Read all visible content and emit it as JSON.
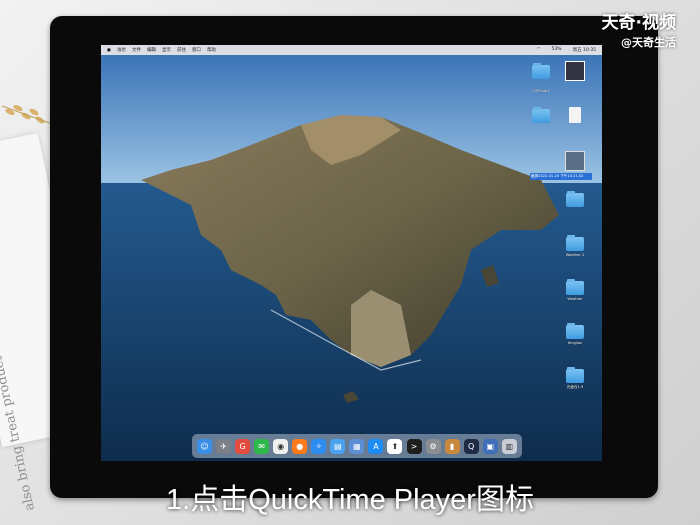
{
  "watermark": {
    "title": "天奇·视频",
    "subtitle": "@天奇生活"
  },
  "paper_text": "also bring treat product",
  "menubar": {
    "items": [
      "访达",
      "文件",
      "编辑",
      "显示",
      "前往",
      "窗口",
      "帮助"
    ],
    "status": [
      "53%",
      "周五 10:35"
    ]
  },
  "desktop_icons": [
    {
      "label": "",
      "kind": "folder"
    },
    {
      "label": "",
      "kind": "image"
    },
    {
      "label": "CSPrism1",
      "kind": "folder"
    },
    {
      "label": "",
      "kind": "file"
    },
    {
      "label": "",
      "kind": "folder"
    },
    {
      "label": "",
      "kind": "file"
    },
    {
      "label": "截屏2022-01-20 下午10.21.02",
      "kind": "image"
    },
    {
      "label": "",
      "kind": "folder"
    },
    {
      "label": "Weather 2",
      "kind": "folder"
    },
    {
      "label": "Weather",
      "kind": "folder"
    },
    {
      "label": "fengjian",
      "kind": "folder"
    },
    {
      "label": "光盘仓1.9",
      "kind": "folder"
    }
  ],
  "dock": [
    {
      "name": "finder-icon",
      "color": "#3a8fe6",
      "glyph": "☺"
    },
    {
      "name": "launchpad-icon",
      "color": "#7a7f88",
      "glyph": "✈"
    },
    {
      "name": "app-icon-red",
      "color": "#e24b3d",
      "glyph": "G"
    },
    {
      "name": "wechat-icon",
      "color": "#2fb84a",
      "glyph": "✉"
    },
    {
      "name": "chrome-icon",
      "color": "#f0f0f0",
      "glyph": "◉"
    },
    {
      "name": "firefox-icon",
      "color": "#ff7a1a",
      "glyph": "●"
    },
    {
      "name": "safari-icon",
      "color": "#2c8cf0",
      "glyph": "✧"
    },
    {
      "name": "files-icon",
      "color": "#4aa3f0",
      "glyph": "▤"
    },
    {
      "name": "stack-icon",
      "color": "#5e8fd6",
      "glyph": "▦"
    },
    {
      "name": "appstore-icon",
      "color": "#1d8df5",
      "glyph": "A"
    },
    {
      "name": "upload-icon",
      "color": "#ffffff",
      "glyph": "⬆"
    },
    {
      "name": "terminal-icon",
      "color": "#1e1e1e",
      "glyph": ">"
    },
    {
      "name": "settings-icon",
      "color": "#8b8e93",
      "glyph": "⚙"
    },
    {
      "name": "book-icon",
      "color": "#c8893f",
      "glyph": "▮"
    },
    {
      "name": "quicktime-icon",
      "color": "#1f2b46",
      "glyph": "Q"
    },
    {
      "name": "preview-icon",
      "color": "#3f6fb8",
      "glyph": "▣"
    },
    {
      "name": "trash-icon",
      "color": "#c9ced6",
      "glyph": "▥"
    }
  ],
  "caption": "1.点击QuickTime Player图标"
}
